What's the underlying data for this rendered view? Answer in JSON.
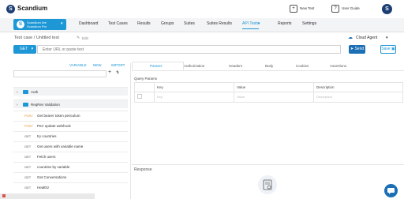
{
  "app": {
    "brand": "Scandium",
    "new_test": "New Test",
    "user_guide": "User Guide"
  },
  "project": {
    "line1": "Scandium live",
    "line2": "Scandium Pro"
  },
  "nav": {
    "items": [
      "Dashboard",
      "Test Cases",
      "Results",
      "Groups",
      "Suites",
      "Suites Results",
      "API Tests",
      "Reports",
      "Settings"
    ],
    "active_index": 6
  },
  "testcase": {
    "title": "Test case / Untitled test",
    "edit": "Edit",
    "agent": "Cloud Agent"
  },
  "request": {
    "method": "GET",
    "url_placeholder": "Enter URL or paste text",
    "send": "Send",
    "save": "Save"
  },
  "left_tabs": [
    "VARIABLE",
    "NEW",
    "IMPORT"
  ],
  "tree": [
    {
      "kind": "folder",
      "label": "Auth"
    },
    {
      "kind": "folder",
      "label": "ReqRes Validation"
    },
    {
      "kind": "req",
      "method": "POST",
      "label": "Get bearer token periculum"
    },
    {
      "kind": "req",
      "method": "POST",
      "label": "Perr update webhook"
    },
    {
      "kind": "req",
      "method": "GET",
      "label": "try countries"
    },
    {
      "kind": "req",
      "method": "GET",
      "label": "Get users with variable name"
    },
    {
      "kind": "req",
      "method": "GET",
      "label": "Fetch users"
    },
    {
      "kind": "req",
      "method": "GET",
      "label": "countries by variable"
    },
    {
      "kind": "req",
      "method": "GET",
      "label": "Get Conversations"
    },
    {
      "kind": "req",
      "method": "GET",
      "label": "Healthz"
    }
  ],
  "req_tabs": [
    "Params",
    "Authorization",
    "Headers",
    "Body",
    "Cookies",
    "Assertions"
  ],
  "params": {
    "section": "Query Params",
    "headers": [
      "Key",
      "Value",
      "Description"
    ],
    "row": [
      "Key",
      "Value",
      "Description"
    ]
  },
  "response_label": "Response"
}
